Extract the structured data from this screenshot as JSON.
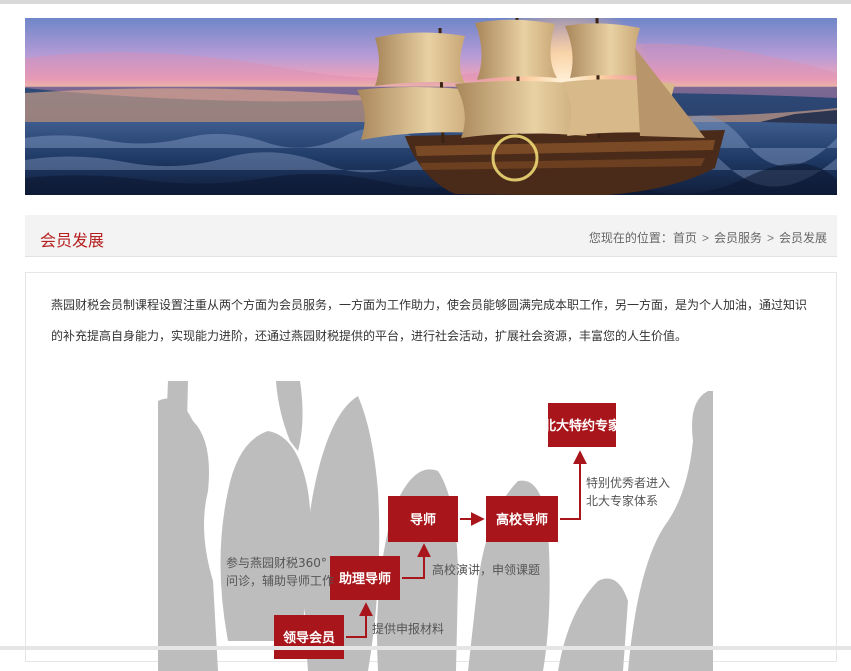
{
  "header": {
    "banner_image": "sailing-ship-at-sunset"
  },
  "title_bar": {
    "title": "会员发展",
    "breadcrumb": {
      "prefix": "您现在的位置：",
      "items": [
        "首页",
        "会员服务",
        "会员发展"
      ],
      "separator": ">"
    }
  },
  "content": {
    "intro": "燕园财税会员制课程设置注重从两个方面为会员服务，一方面为工作助力，使会员能够圆满完成本职工作，另一方面，是为个人加油，通过知识的补充提高自身能力，实现能力进阶，还通过燕园财税提供的平台，进行社会活动，扩展社会资源，丰富您的人生价值。",
    "diagram": {
      "boxes": {
        "expert": "北大特约专家",
        "tutor": "导师",
        "university_tutor": "高校导师",
        "assistant_tutor": "助理导师",
        "lead_member": "领导会员"
      },
      "notes": {
        "expert_line1": "特别优秀者进入",
        "expert_line2": "北大专家体系",
        "assistant_line1": "参与燕园财税360°",
        "assistant_line2": "问诊，辅助导师工作",
        "tutor_arrow": "高校演讲，申领课题",
        "lead_arrow": "提供申报材料"
      }
    }
  },
  "colors": {
    "accent": "#b5201f",
    "box_fill": "#a8151a",
    "silhouette": "#bdbdbd",
    "breadcrumb_text": "#666666"
  }
}
